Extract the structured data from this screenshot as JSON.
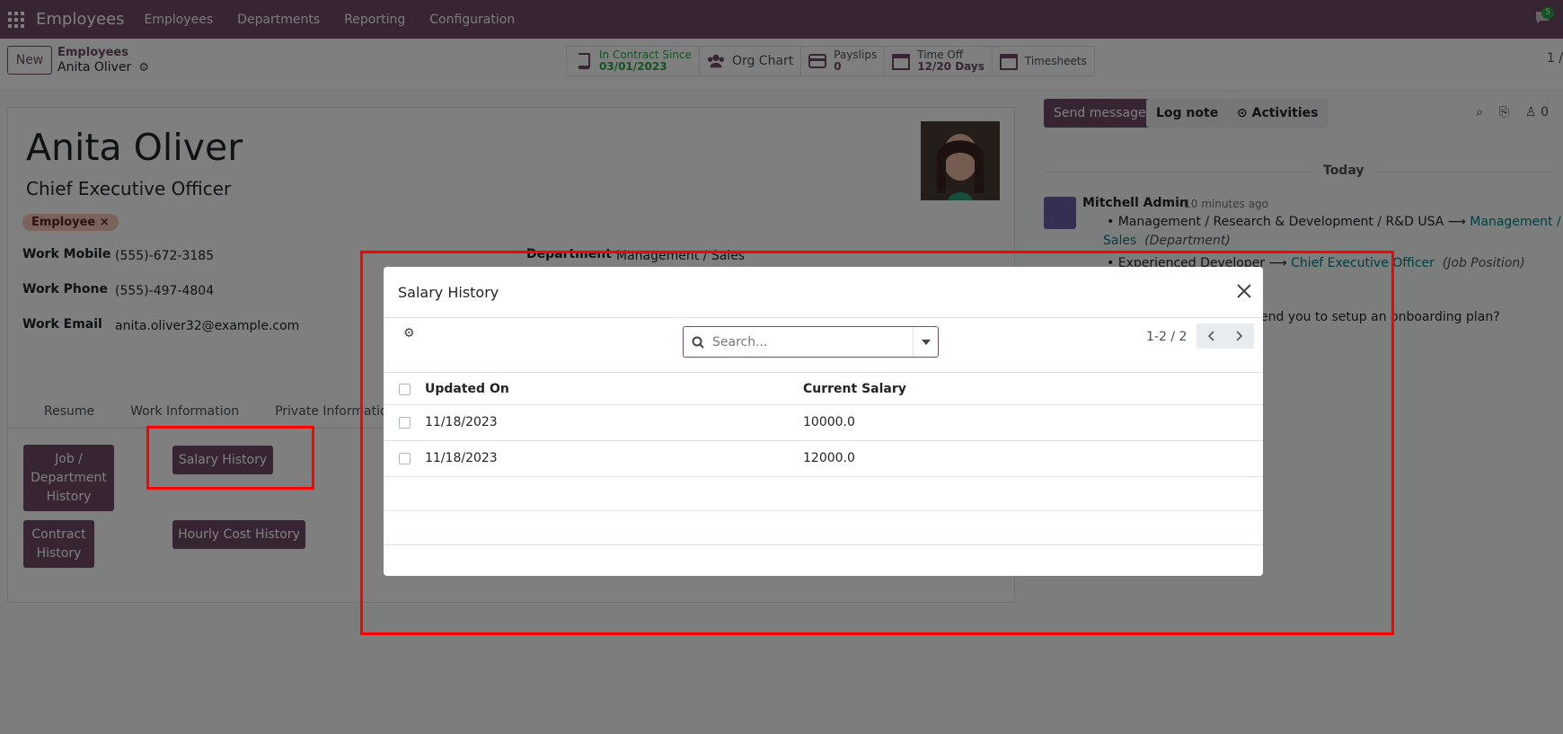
{
  "navbar": {
    "brand": "Employees",
    "menu": [
      "Employees",
      "Departments",
      "Reporting",
      "Configuration"
    ],
    "chat_count": "5"
  },
  "control": {
    "new_label": "New",
    "breadcrumb_parent": "Employees",
    "breadcrumb_current": "Anita Oliver",
    "smart_buttons": {
      "contract_label": "In Contract Since",
      "contract_value": "03/01/2023",
      "org_chart": "Org Chart",
      "payslips_label": "Payslips",
      "payslips_value": "0",
      "timeoff_label": "Time Off",
      "timeoff_value": "12/20 Days",
      "timesheets": "Timesheets"
    },
    "pager": "1 /"
  },
  "employee": {
    "name": "Anita Oliver",
    "job_title": "Chief Executive Officer",
    "tag": "Employee",
    "work_mobile_label": "Work Mobile",
    "work_mobile": "(555)-672-3185",
    "work_phone_label": "Work Phone",
    "work_phone": "(555)-497-4804",
    "work_email_label": "Work Email",
    "work_email": "anita.oliver32@example.com",
    "department_label": "Department",
    "department": "Management / Sales",
    "tabs": [
      "Resume",
      "Work Information",
      "Private Information"
    ],
    "buttons": {
      "job_history": "Job / Department History",
      "salary_history": "Salary History",
      "contract_history": "Contract History",
      "hourly_cost_history": "Hourly Cost History"
    }
  },
  "chatter": {
    "send_message": "Send message",
    "log_note": "Log note",
    "activities": "Activities",
    "followers_count": "0",
    "today": "Today",
    "message": {
      "author": "Mitchell Admin",
      "time": "- 10 minutes ago",
      "line1_old": "Management / Research & Development / R&D USA",
      "line1_new": "Management /",
      "line1_new_cont": "Sales",
      "line1_field": "(Department)",
      "line2_old": "Experienced Developer",
      "line2_new": "Chief Executive Officer",
      "line2_field": "(Job Position)",
      "onboarding_text": "end you to setup an onboarding plan?"
    }
  },
  "modal": {
    "title": "Salary History",
    "search_placeholder": "Search...",
    "pager": "1-2 / 2",
    "columns": [
      "Updated On",
      "Current Salary"
    ],
    "rows": [
      {
        "updated_on": "11/18/2023",
        "current_salary": "10000.0"
      },
      {
        "updated_on": "11/18/2023",
        "current_salary": "12000.0"
      }
    ]
  },
  "colors": {
    "brand": "#714b67",
    "highlight": "#ff0000",
    "link": "#017e84"
  }
}
